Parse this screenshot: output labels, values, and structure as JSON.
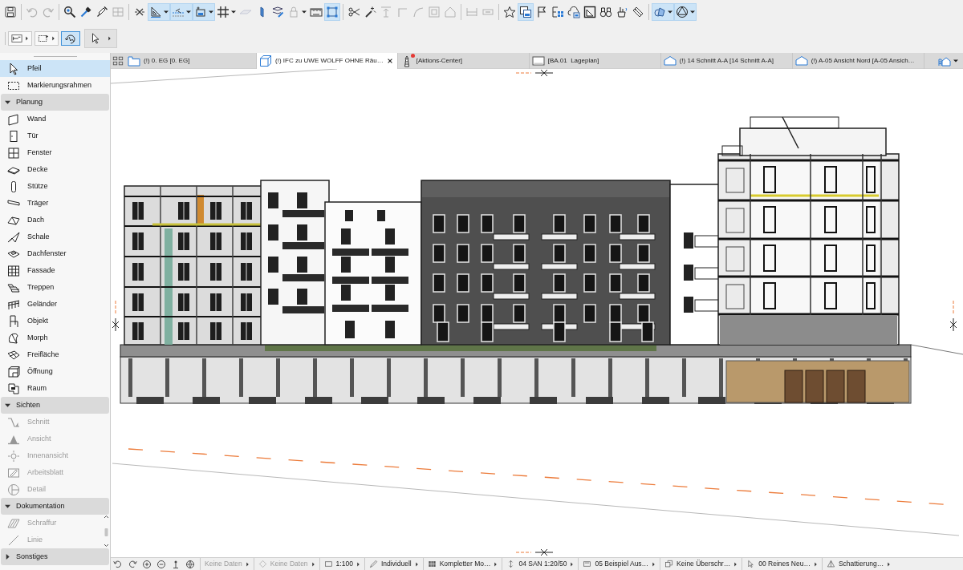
{
  "toolbar": {
    "groups": [
      [
        {
          "selected": false,
          "disabled": false,
          "menu": false
        }
      ],
      [
        {
          "selected": false,
          "disabled": true,
          "menu": false
        },
        {
          "selected": false,
          "disabled": true,
          "menu": false
        }
      ],
      [
        {
          "selected": false,
          "disabled": false,
          "menu": false
        },
        {
          "selected": false,
          "disabled": false,
          "menu": false
        },
        {
          "selected": false,
          "disabled": false,
          "menu": false
        },
        {
          "selected": false,
          "disabled": true,
          "menu": false
        }
      ],
      [
        {
          "selected": false,
          "disabled": false,
          "menu": false
        },
        {
          "selected": true,
          "disabled": false,
          "menu": true
        },
        {
          "selected": true,
          "disabled": false,
          "menu": true
        },
        {
          "selected": true,
          "disabled": false,
          "menu": true
        },
        {
          "selected": false,
          "disabled": false,
          "menu": true
        },
        {
          "selected": false,
          "disabled": true,
          "menu": false
        },
        {
          "selected": false,
          "disabled": false,
          "menu": false
        },
        {
          "selected": false,
          "disabled": false,
          "menu": false
        },
        {
          "selected": false,
          "disabled": true,
          "menu": true
        },
        {
          "selected": false,
          "disabled": false,
          "menu": false
        },
        {
          "selected": true,
          "disabled": false,
          "menu": false
        }
      ],
      [
        {
          "selected": false,
          "disabled": false,
          "menu": false
        },
        {
          "selected": false,
          "disabled": false,
          "menu": false
        },
        {
          "selected": false,
          "disabled": true,
          "menu": false
        },
        {
          "selected": false,
          "disabled": true,
          "menu": false
        },
        {
          "selected": false,
          "disabled": true,
          "menu": false
        },
        {
          "selected": false,
          "disabled": true,
          "menu": false
        },
        {
          "selected": false,
          "disabled": true,
          "menu": false
        }
      ],
      [
        {
          "selected": false,
          "disabled": true,
          "menu": false
        },
        {
          "selected": false,
          "disabled": true,
          "menu": false
        }
      ],
      [
        {
          "selected": false,
          "disabled": false,
          "menu": false
        },
        {
          "selected": true,
          "disabled": false,
          "menu": false
        },
        {
          "selected": false,
          "disabled": false,
          "menu": false
        },
        {
          "selected": false,
          "disabled": false,
          "menu": false
        },
        {
          "selected": false,
          "disabled": false,
          "menu": false
        },
        {
          "selected": false,
          "disabled": false,
          "menu": false
        },
        {
          "selected": false,
          "disabled": false,
          "menu": false
        },
        {
          "selected": false,
          "disabled": false,
          "menu": false
        },
        {
          "selected": false,
          "disabled": false,
          "menu": false
        }
      ],
      [
        {
          "selected": true,
          "disabled": false,
          "menu": true
        },
        {
          "selected": true,
          "disabled": false,
          "menu": true
        }
      ]
    ]
  },
  "tool_options": [
    {
      "selected": false,
      "menu": true
    },
    {
      "selected": false,
      "menu": true
    },
    {
      "selected": true,
      "menu": false
    },
    {
      "selected": false,
      "menu": true
    }
  ],
  "sidebar": {
    "sections": [
      {
        "items": [
          {
            "label": "Pfeil",
            "selected": true,
            "disabled": false
          },
          {
            "label": "Markierungsrahmen",
            "selected": false,
            "disabled": false
          }
        ]
      },
      {
        "title": "Planung",
        "expanded": true,
        "items": [
          {
            "label": "Wand",
            "selected": false,
            "disabled": false
          },
          {
            "label": "Tür",
            "selected": false,
            "disabled": false
          },
          {
            "label": "Fenster",
            "selected": false,
            "disabled": false
          },
          {
            "label": "Decke",
            "selected": false,
            "disabled": false
          },
          {
            "label": "Stütze",
            "selected": false,
            "disabled": false
          },
          {
            "label": "Träger",
            "selected": false,
            "disabled": false
          },
          {
            "label": "Dach",
            "selected": false,
            "disabled": false
          },
          {
            "label": "Schale",
            "selected": false,
            "disabled": false
          },
          {
            "label": "Dachfenster",
            "selected": false,
            "disabled": false
          },
          {
            "label": "Fassade",
            "selected": false,
            "disabled": false
          },
          {
            "label": "Treppen",
            "selected": false,
            "disabled": false
          },
          {
            "label": "Geländer",
            "selected": false,
            "disabled": false
          },
          {
            "label": "Objekt",
            "selected": false,
            "disabled": false
          },
          {
            "label": "Morph",
            "selected": false,
            "disabled": false
          },
          {
            "label": "Freifläche",
            "selected": false,
            "disabled": false
          },
          {
            "label": "Öffnung",
            "selected": false,
            "disabled": false
          },
          {
            "label": "Raum",
            "selected": false,
            "disabled": false
          }
        ]
      },
      {
        "title": "Sichten",
        "expanded": true,
        "items": [
          {
            "label": "Schnitt",
            "selected": false,
            "disabled": true
          },
          {
            "label": "Ansicht",
            "selected": false,
            "disabled": true
          },
          {
            "label": "Innenansicht",
            "selected": false,
            "disabled": true
          },
          {
            "label": "Arbeitsblatt",
            "selected": false,
            "disabled": true
          },
          {
            "label": "Detail",
            "selected": false,
            "disabled": true
          }
        ]
      },
      {
        "title": "Dokumentation",
        "expanded": true,
        "items": [
          {
            "label": "Schraffur",
            "selected": false,
            "disabled": true
          },
          {
            "label": "Linie",
            "selected": false,
            "disabled": true
          }
        ]
      },
      {
        "title": "Sonstiges",
        "expanded": false
      }
    ]
  },
  "tabs": [
    {
      "label": "(!) 0. EG [0. EG]",
      "selected": false,
      "notification": false
    },
    {
      "label": "(!) IFC zu UWE WOLFF OHNE Räu…",
      "selected": true,
      "notification": false
    },
    {
      "label": "[Aktions-Center]",
      "selected": false,
      "notification": true
    },
    {
      "label": "[BA.01  Lageplan]",
      "selected": false,
      "notification": false
    },
    {
      "label": "(!) 14 Schnitt A-A [14 Schnitt A-A]",
      "selected": false,
      "notification": false
    },
    {
      "label": "(!) A-05 Ansicht Nord [A-05 Ansich…",
      "selected": false,
      "notification": false
    }
  ],
  "status_bar": [
    {
      "label": "Keine Daten",
      "menu": true,
      "disabled": true
    },
    {
      "label": "Keine Daten",
      "menu": true,
      "disabled": true
    },
    {
      "label": "1:100",
      "menu": true,
      "disabled": false
    },
    {
      "label": "Individuell",
      "menu": true,
      "disabled": false
    },
    {
      "label": "Kompletter Mo…",
      "menu": true,
      "disabled": false
    },
    {
      "label": "04 SAN 1:20/50",
      "menu": true,
      "disabled": false
    },
    {
      "label": "05 Beispiel Aus…",
      "menu": true,
      "disabled": false
    },
    {
      "label": "Keine Überschr…",
      "menu": true,
      "disabled": false
    },
    {
      "label": "00 Reines Neu…",
      "menu": true,
      "disabled": false
    },
    {
      "label": "Schattierung…",
      "menu": true,
      "disabled": false
    }
  ]
}
